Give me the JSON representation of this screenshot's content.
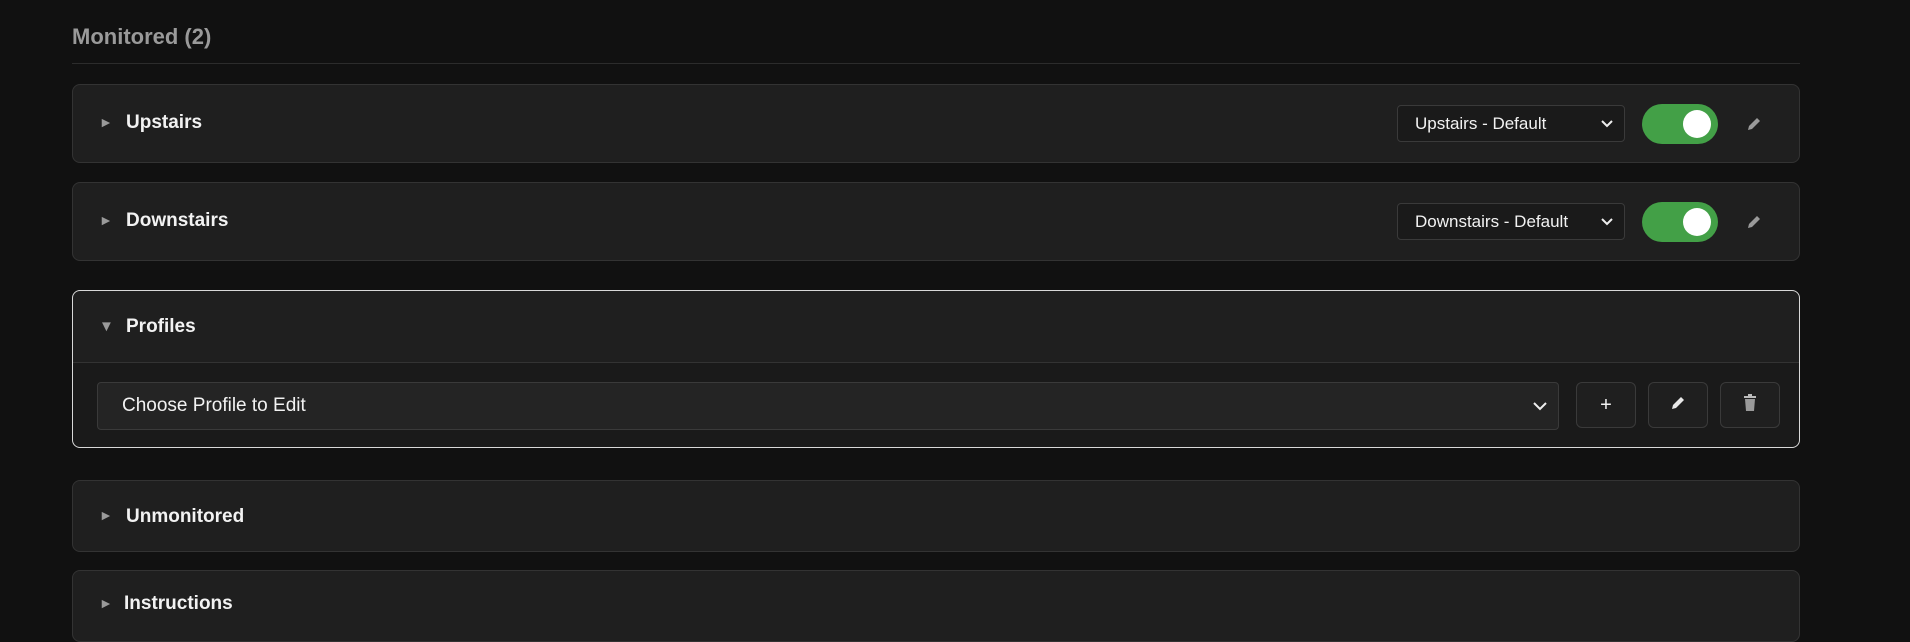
{
  "monitored": {
    "title": "Monitored (2)"
  },
  "devices": [
    {
      "name": "Upstairs",
      "profile": "Upstairs - Default",
      "enabled": true,
      "arrow": "►"
    },
    {
      "name": "Downstairs",
      "profile": "Downstairs - Default",
      "enabled": true,
      "arrow": "►"
    }
  ],
  "profiles": {
    "title": "Profiles",
    "arrow": "▼",
    "select_value": "Choose Profile to Edit",
    "add_label": "+"
  },
  "unmonitored": {
    "title": "Unmonitored",
    "arrow": "►"
  },
  "instructions": {
    "title": "Instructions",
    "arrow": "►"
  },
  "colors": {
    "toggle_on": "#43a047",
    "background": "#111111",
    "card": "#1f1f1f"
  },
  "icons": [
    "chevron-down-icon",
    "pencil-icon",
    "trash-icon",
    "plus-icon",
    "triangle-right-icon",
    "triangle-down-icon"
  ]
}
